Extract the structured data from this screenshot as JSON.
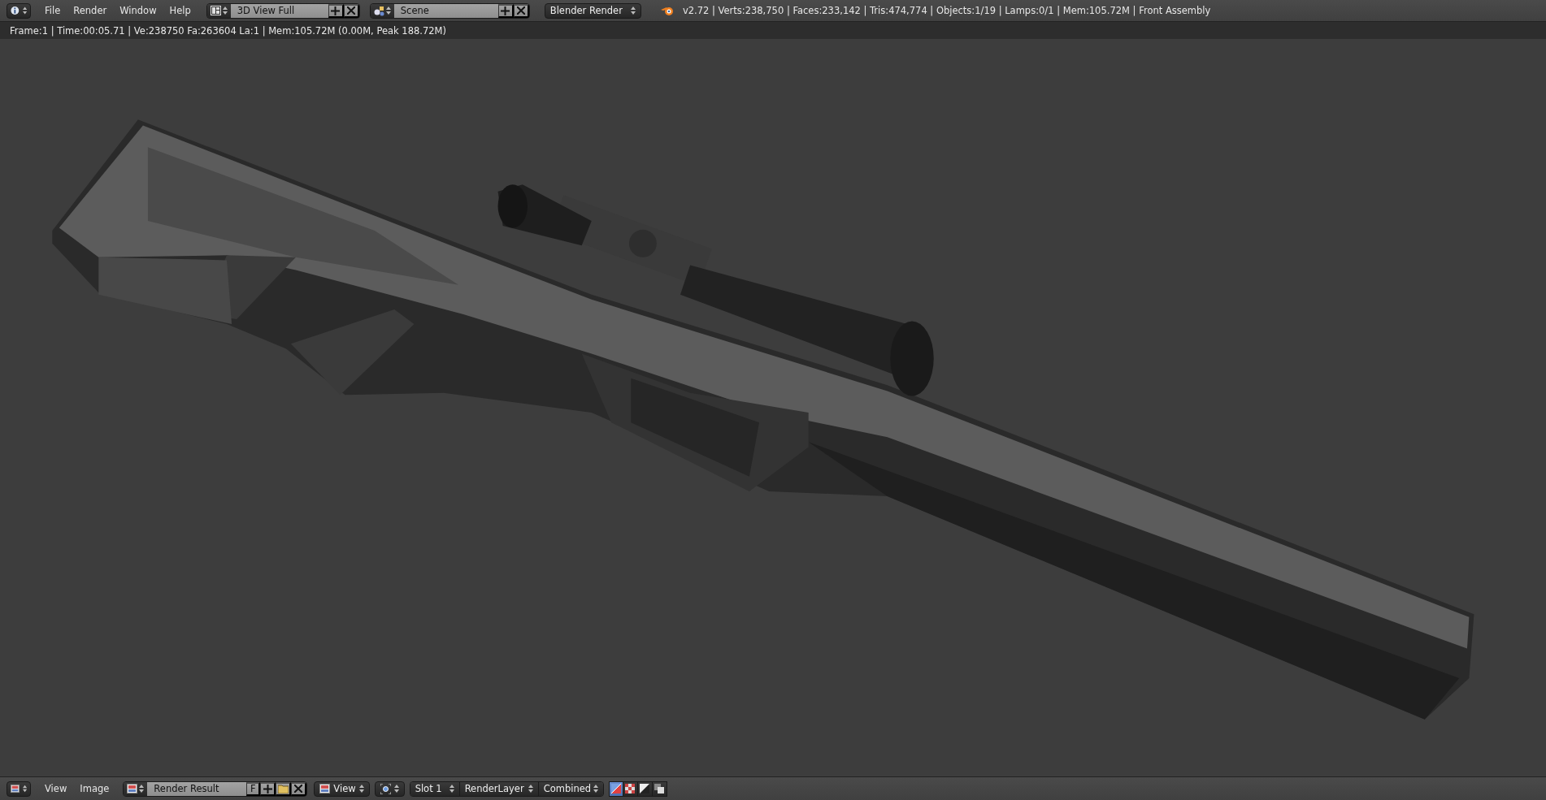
{
  "top_header": {
    "menus": [
      "File",
      "Render",
      "Window",
      "Help"
    ],
    "screen_layout": "3D View Full",
    "scene": "Scene",
    "render_engine": "Blender Render",
    "stats": "v2.72 | Verts:238,750 | Faces:233,142 | Tris:474,774 | Objects:1/19 | Lamps:0/1 | Mem:105.72M | Front Assembly"
  },
  "render_info": "Frame:1 | Time:00:05.71 | Ve:238750 Fa:263604 La:1 | Mem:105.72M (0.00M, Peak 188.72M)",
  "image_editor_header": {
    "menus": [
      "View",
      "Image"
    ],
    "image": "Render Result",
    "fake_user": "F",
    "view_menu": "View",
    "slot": "Slot 1",
    "render_layer": "RenderLayer",
    "render_pass": "Combined",
    "display_channels": [
      {
        "kind": "color-alpha",
        "selected": true
      },
      {
        "kind": "alpha-checker",
        "selected": false
      },
      {
        "kind": "z-buffer",
        "selected": false
      },
      {
        "kind": "color",
        "selected": false
      }
    ]
  }
}
